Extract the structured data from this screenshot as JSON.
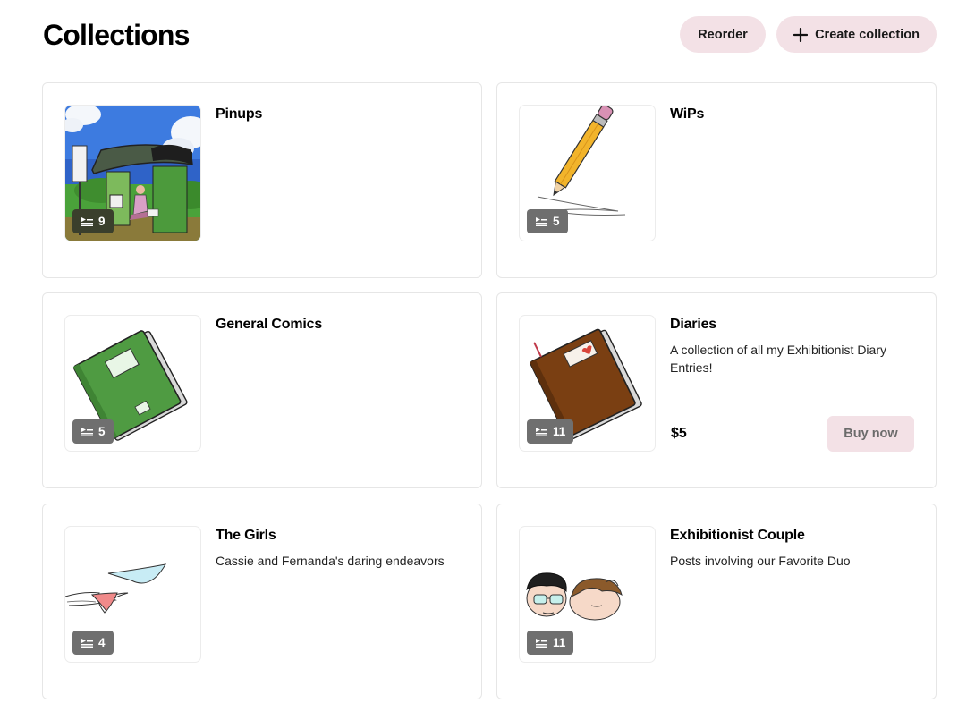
{
  "page": {
    "title": "Collections"
  },
  "header": {
    "reorder_label": "Reorder",
    "create_label": "Create collection"
  },
  "collections": [
    {
      "name": "Pinups",
      "count": "9",
      "description": "",
      "thumb_icon": "bus-stop-illustration"
    },
    {
      "name": "WiPs",
      "count": "5",
      "description": "",
      "thumb_icon": "pencil-illustration"
    },
    {
      "name": "General Comics",
      "count": "5",
      "description": "",
      "thumb_icon": "green-book-illustration"
    },
    {
      "name": "Diaries",
      "count": "11",
      "description": "A collection of all my Exhibitionist Diary Entries!",
      "price": "$5",
      "buy_label": "Buy now",
      "thumb_icon": "brown-diary-illustration"
    },
    {
      "name": "The Girls",
      "count": "4",
      "description": "Cassie and Fernanda's daring endeavors",
      "thumb_icon": "flying-underwear-illustration"
    },
    {
      "name": "Exhibitionist Couple",
      "count": "11",
      "description": "Posts involving our Favorite Duo",
      "thumb_icon": "couple-faces-illustration"
    }
  ],
  "colors": {
    "accent_button": "#f3e1e6",
    "count_badge": "#6f6f6f",
    "card_border": "#e6e6e6"
  },
  "icons": {
    "plus": "plus-icon",
    "count": "media-list-icon"
  }
}
